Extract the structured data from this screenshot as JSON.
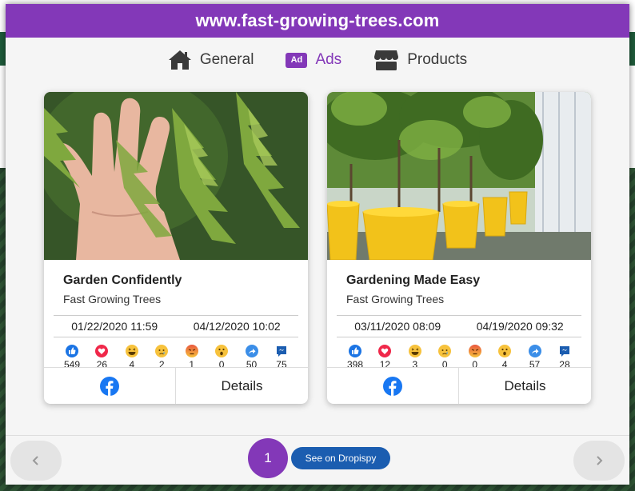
{
  "header": {
    "title": "www.fast-growing-trees.com"
  },
  "tabs": [
    {
      "label": "General",
      "icon": "home-icon"
    },
    {
      "label": "Ads",
      "icon": "ad-icon",
      "badge": "Ad",
      "active": true
    },
    {
      "label": "Products",
      "icon": "store-icon"
    }
  ],
  "cards": [
    {
      "title": "Garden Confidently",
      "advertiser": "Fast Growing Trees",
      "start_date": "01/22/2020 11:59",
      "end_date": "04/12/2020 10:02",
      "reactions": {
        "like": "549",
        "love": "26",
        "haha": "4",
        "sad": "2",
        "angry": "1",
        "wow": "0",
        "shares": "50",
        "comments": "75"
      },
      "details_label": "Details"
    },
    {
      "title": "Gardening Made Easy",
      "advertiser": "Fast Growing Trees",
      "start_date": "03/11/2020 08:09",
      "end_date": "04/19/2020 09:32",
      "reactions": {
        "like": "398",
        "love": "12",
        "haha": "3",
        "sad": "0",
        "angry": "0",
        "wow": "4",
        "shares": "57",
        "comments": "28"
      },
      "details_label": "Details"
    }
  ],
  "pagination": {
    "current_page": "1",
    "prev_icon": "chevron-left-icon",
    "next_icon": "chevron-right-icon"
  },
  "dropispy_button": {
    "label": "See on Dropispy"
  },
  "colors": {
    "accent": "#8338b8",
    "dropispy": "#1b5db0",
    "facebook": "#1877f2"
  }
}
